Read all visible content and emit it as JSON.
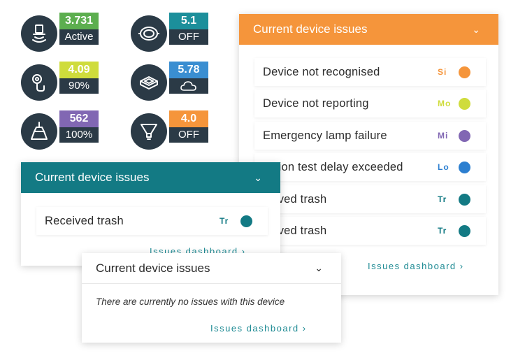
{
  "tiles": [
    {
      "value": "3.731",
      "status": "Active",
      "color": "#5cae4f",
      "icon": "pendant-lamp-icon"
    },
    {
      "value": "5.1",
      "status": "OFF",
      "color": "#1c8f9b",
      "icon": "bulkhead-light-icon"
    },
    {
      "value": "4.09",
      "status": "90%",
      "color": "#cfdc3c",
      "icon": "sensor-probe-icon"
    },
    {
      "value": "5.78",
      "status": "",
      "color": "#3a8ed1",
      "icon": "floodlight-icon",
      "status_icon": "cloud-icon"
    },
    {
      "value": "562",
      "status": "100%",
      "color": "#8167b3",
      "icon": "ceiling-lamp-icon"
    },
    {
      "value": "4.0",
      "status": "OFF",
      "color": "#f5953b",
      "icon": "spotlight-icon"
    }
  ],
  "panel_main": {
    "title": "Current device issues",
    "header_color": "#f5953b",
    "issues": [
      {
        "label": "Device not recognised",
        "code": "Si",
        "color": "#f5953b"
      },
      {
        "label": "Device not reporting",
        "code": "Mo",
        "color": "#cfdc3c"
      },
      {
        "label": "Emergency lamp failure",
        "code": "Mi",
        "color": "#8167b3"
      },
      {
        "label": "nction test delay exceeded",
        "code": "Lo",
        "color": "#2c7fd0"
      },
      {
        "label": "ceived trash",
        "code": "Tr",
        "color": "#137a84"
      },
      {
        "label": "ceived trash",
        "code": "Tr",
        "color": "#137a84"
      }
    ],
    "link": "Issues dashboard ›"
  },
  "panel_teal": {
    "title": "Current device issues",
    "header_color": "#137a84",
    "issues": [
      {
        "label": "Received trash",
        "code": "Tr",
        "color": "#137a84"
      }
    ],
    "link": "Issues dashboard ›"
  },
  "panel_empty": {
    "title": "Current device issues",
    "message": "There are currently no issues with this device",
    "link": "Issues dashboard ›"
  }
}
